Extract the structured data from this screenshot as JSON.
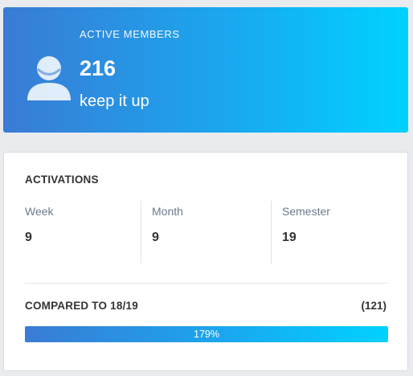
{
  "banner": {
    "eyebrow": "ACTIVE MEMBERS",
    "count": "216",
    "tagline": "keep it up",
    "icon": "user-icon",
    "gradient_start": "#3a7bd5",
    "gradient_end": "#00d2ff"
  },
  "activations": {
    "title": "ACTIVATIONS",
    "stats": [
      {
        "label": "Week",
        "value": "9"
      },
      {
        "label": "Month",
        "value": "9"
      },
      {
        "label": "Semester",
        "value": "19"
      }
    ]
  },
  "comparison": {
    "title": "COMPARED TO 18/19",
    "count": "(121)",
    "progress_label": "179%",
    "progress_fraction": 1.0
  }
}
